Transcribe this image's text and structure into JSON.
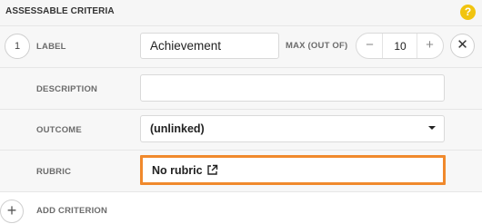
{
  "header": {
    "title": "ASSESSABLE CRITERIA",
    "help_icon": "?"
  },
  "criterion": {
    "number": "1",
    "label_text": "LABEL",
    "label_value": "Achievement",
    "max_label": "MAX (OUT OF)",
    "max_value": "10",
    "minus_icon": "−",
    "plus_icon": "+",
    "remove_icon": "✕",
    "description_label": "DESCRIPTION",
    "description_value": "",
    "outcome_label": "OUTCOME",
    "outcome_value": "(unlinked)",
    "rubric_label": "RUBRIC",
    "rubric_value": "No rubric"
  },
  "add": {
    "icon": "+",
    "label": "ADD CRITERION"
  },
  "colors": {
    "rubric_highlight": "#f0892c",
    "help_badge": "#f1c40f"
  }
}
